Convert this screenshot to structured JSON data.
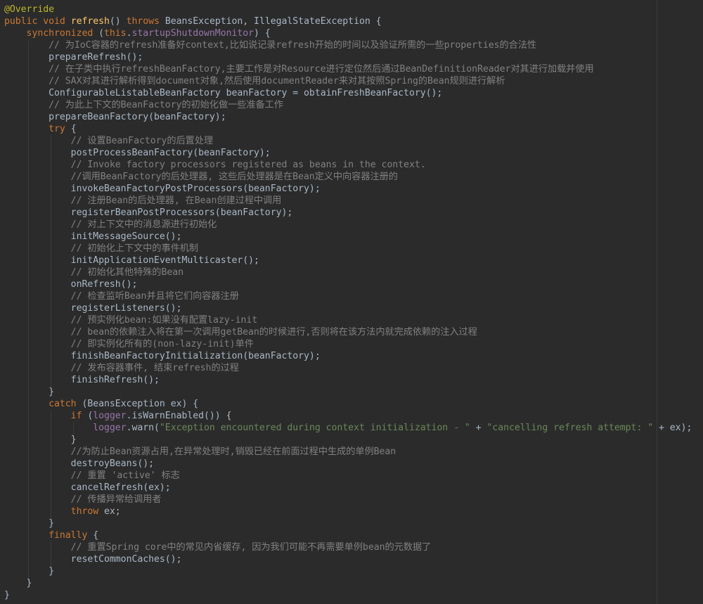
{
  "editor": {
    "lines": [
      [
        {
          "t": "@Override",
          "c": "ann"
        }
      ],
      [
        {
          "t": "public void ",
          "c": "kw"
        },
        {
          "t": "refresh",
          "c": "fn"
        },
        {
          "t": "() ",
          "c": "pl"
        },
        {
          "t": "throws ",
          "c": "kw"
        },
        {
          "t": "BeansException, IllegalStateException {",
          "c": "pl"
        }
      ],
      [
        {
          "t": "    synchronized ",
          "c": "kw"
        },
        {
          "t": "(",
          "c": "pl"
        },
        {
          "t": "this",
          "c": "kw"
        },
        {
          "t": ".",
          "c": "pl"
        },
        {
          "t": "startupShutdownMonitor",
          "c": "fld"
        },
        {
          "t": ") {",
          "c": "pl"
        }
      ],
      [
        {
          "t": "        // 为IoC容器的refresh准备好context,比如说记录refresh开始的时间以及验证所需的一些properties的合法性",
          "c": "cmt"
        }
      ],
      [
        {
          "t": "        prepareRefresh();",
          "c": "pl"
        }
      ],
      [
        {
          "t": "        // 在子类中执行refreshBeanFactory,主要工作是对Resource进行定位然后通过BeanDefinitionReader对其进行加载并使用",
          "c": "cmt"
        }
      ],
      [
        {
          "t": "        // SAX对其进行解析得到document对象,然后使用documentReader来对其按照Spring的Bean规则进行解析",
          "c": "cmt"
        }
      ],
      [
        {
          "t": "        ConfigurableListableBeanFactory beanFactory = obtainFreshBeanFactory();",
          "c": "pl"
        }
      ],
      [
        {
          "t": "        // 为此上下文的BeanFactory的初始化做一些准备工作",
          "c": "cmt"
        }
      ],
      [
        {
          "t": "        prepareBeanFactory(beanFactory);",
          "c": "pl"
        }
      ],
      [
        {
          "t": "        try ",
          "c": "kw"
        },
        {
          "t": "{",
          "c": "pl"
        }
      ],
      [
        {
          "t": "            // 设置BeanFactory的后置处理",
          "c": "cmt"
        }
      ],
      [
        {
          "t": "            postProcessBeanFactory(beanFactory);",
          "c": "pl"
        }
      ],
      [
        {
          "t": "            // Invoke factory processors registered as beans in the context.",
          "c": "cmt"
        }
      ],
      [
        {
          "t": "            //调用BeanFactory的后处理器, 这些后处理器是在Bean定义中向容器注册的",
          "c": "cmt"
        }
      ],
      [
        {
          "t": "            invokeBeanFactoryPostProcessors(beanFactory);",
          "c": "pl"
        }
      ],
      [
        {
          "t": "            // 注册Bean的后处理器, 在Bean创建过程中调用",
          "c": "cmt"
        }
      ],
      [
        {
          "t": "            registerBeanPostProcessors(beanFactory);",
          "c": "pl"
        }
      ],
      [
        {
          "t": "            // 对上下文中的消息源进行初始化",
          "c": "cmt"
        }
      ],
      [
        {
          "t": "            initMessageSource();",
          "c": "pl"
        }
      ],
      [
        {
          "t": "            // 初始化上下文中的事件机制",
          "c": "cmt"
        }
      ],
      [
        {
          "t": "            initApplicationEventMulticaster();",
          "c": "pl"
        }
      ],
      [
        {
          "t": "            // 初始化其他特殊的Bean",
          "c": "cmt"
        }
      ],
      [
        {
          "t": "            onRefresh();",
          "c": "pl"
        }
      ],
      [
        {
          "t": "            // 检查监听Bean并且将它们向容器注册",
          "c": "cmt"
        }
      ],
      [
        {
          "t": "            registerListeners();",
          "c": "pl"
        }
      ],
      [
        {
          "t": "            // 预实例化bean:如果没有配置lazy-init",
          "c": "cmt"
        }
      ],
      [
        {
          "t": "            // bean的依赖注入将在第一次调用getBean的时候进行,否则将在该方法内就完成依赖的注入过程",
          "c": "cmt"
        }
      ],
      [
        {
          "t": "            // 即实例化所有的(non-lazy-init)单件",
          "c": "cmt"
        }
      ],
      [
        {
          "t": "            finishBeanFactoryInitialization(beanFactory);",
          "c": "pl"
        }
      ],
      [
        {
          "t": "            // 发布容器事件, 结束refresh的过程",
          "c": "cmt"
        }
      ],
      [
        {
          "t": "            finishRefresh();",
          "c": "pl"
        }
      ],
      [
        {
          "t": "        }",
          "c": "pl"
        }
      ],
      [
        {
          "t": "        catch ",
          "c": "kw"
        },
        {
          "t": "(BeansException ex) {",
          "c": "pl"
        }
      ],
      [
        {
          "t": "            if ",
          "c": "kw"
        },
        {
          "t": "(",
          "c": "pl"
        },
        {
          "t": "logger",
          "c": "fld"
        },
        {
          "t": ".isWarnEnabled()) {",
          "c": "pl"
        }
      ],
      [
        {
          "t": "                ",
          "c": "pl"
        },
        {
          "t": "logger",
          "c": "fld"
        },
        {
          "t": ".warn(",
          "c": "pl"
        },
        {
          "t": "\"Exception encountered during context initialization - \"",
          "c": "str"
        },
        {
          "t": " + ",
          "c": "pl"
        },
        {
          "t": "\"cancelling refresh attempt: \"",
          "c": "str"
        },
        {
          "t": " + ex);",
          "c": "pl"
        }
      ],
      [
        {
          "t": "            }",
          "c": "pl"
        }
      ],
      [
        {
          "t": "            //为防止Bean资源占用,在异常处理时,销毁已经在前面过程中生成的单例Bean",
          "c": "cmt"
        }
      ],
      [
        {
          "t": "            destroyBeans();",
          "c": "pl"
        }
      ],
      [
        {
          "t": "            // 重置 'active' 标志",
          "c": "cmt"
        }
      ],
      [
        {
          "t": "            cancelRefresh(ex);",
          "c": "pl"
        }
      ],
      [
        {
          "t": "            // 传播异常给调用者",
          "c": "cmt"
        }
      ],
      [
        {
          "t": "            throw ",
          "c": "kw"
        },
        {
          "t": "ex;",
          "c": "pl"
        }
      ],
      [
        {
          "t": "        }",
          "c": "pl"
        }
      ],
      [
        {
          "t": "        finally ",
          "c": "kw"
        },
        {
          "t": "{",
          "c": "pl"
        }
      ],
      [
        {
          "t": "            // 重置Spring core中的常见内省缓存, 因为我们可能不再需要单例bean的元数据了",
          "c": "cmt"
        }
      ],
      [
        {
          "t": "            resetCommonCaches();",
          "c": "pl"
        }
      ],
      [
        {
          "t": "        }",
          "c": "pl"
        }
      ],
      [
        {
          "t": "    }",
          "c": "pl"
        }
      ],
      [
        {
          "t": "}",
          "c": "pl"
        }
      ]
    ],
    "colors": {
      "background": "#2b2b2b",
      "keyword": "#cc7832",
      "method_decl": "#ffc66d",
      "comment": "#808080",
      "string": "#6a8759",
      "field": "#9876aa",
      "annotation": "#bbb529",
      "plain": "#a9b7c6"
    }
  }
}
